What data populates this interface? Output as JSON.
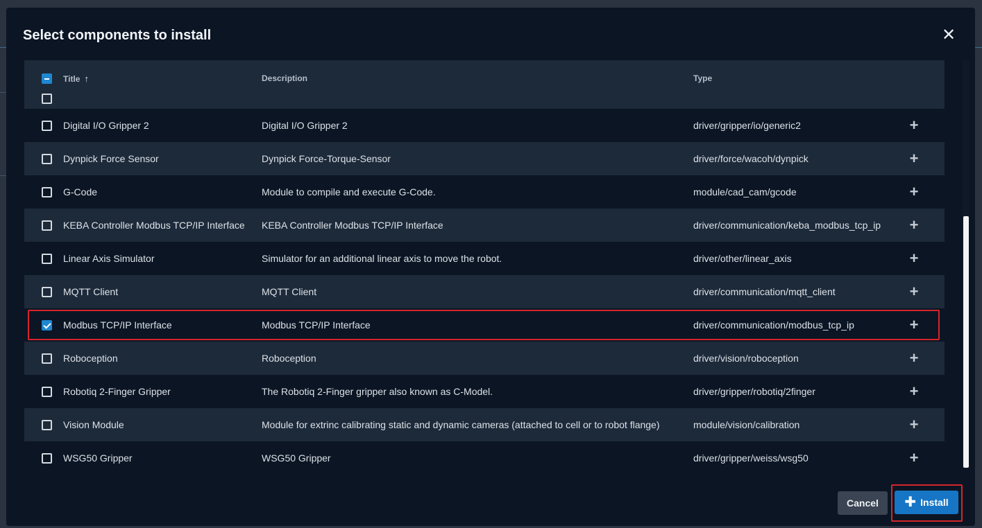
{
  "dialog": {
    "title": "Select components to install",
    "close_icon": "close-icon"
  },
  "table": {
    "columns": {
      "title": "Title",
      "description": "Description",
      "type": "Type"
    },
    "sort_icon": "arrow-up-icon",
    "rows": [
      {
        "title": "Digital I/O Gripper 2",
        "description": "Digital I/O Gripper 2",
        "type": "driver/gripper/io/generic2",
        "checked": false
      },
      {
        "title": "Dynpick Force Sensor",
        "description": "Dynpick Force-Torque-Sensor",
        "type": "driver/force/wacoh/dynpick",
        "checked": false
      },
      {
        "title": "G-Code",
        "description": "Module to compile and execute G-Code.",
        "type": "module/cad_cam/gcode",
        "checked": false
      },
      {
        "title": "KEBA Controller Modbus TCP/IP Interface",
        "description": "KEBA Controller Modbus TCP/IP Interface",
        "type": "driver/communication/keba_modbus_tcp_ip",
        "checked": false
      },
      {
        "title": "Linear Axis Simulator",
        "description": "Simulator for an additional linear axis to move the robot.",
        "type": "driver/other/linear_axis",
        "checked": false
      },
      {
        "title": "MQTT Client",
        "description": "MQTT Client",
        "type": "driver/communication/mqtt_client",
        "checked": false
      },
      {
        "title": "Modbus TCP/IP Interface",
        "description": "Modbus TCP/IP Interface",
        "type": "driver/communication/modbus_tcp_ip",
        "checked": true
      },
      {
        "title": "Roboception",
        "description": "Roboception",
        "type": "driver/vision/roboception",
        "checked": false
      },
      {
        "title": "Robotiq 2-Finger Gripper",
        "description": "The Robotiq 2-Finger gripper also known as C-Model.",
        "type": "driver/gripper/robotiq/2finger",
        "checked": false
      },
      {
        "title": "Vision Module",
        "description": "Module for extrinc calibrating static and dynamic cameras (attached to cell or to robot flange)",
        "type": "module/vision/calibration",
        "checked": false
      },
      {
        "title": "WSG50 Gripper",
        "description": "WSG50 Gripper",
        "type": "driver/gripper/weiss/wsg50",
        "checked": false
      }
    ]
  },
  "footer": {
    "cancel_label": "Cancel",
    "install_label": "Install",
    "install_icon": "plus-icon"
  }
}
